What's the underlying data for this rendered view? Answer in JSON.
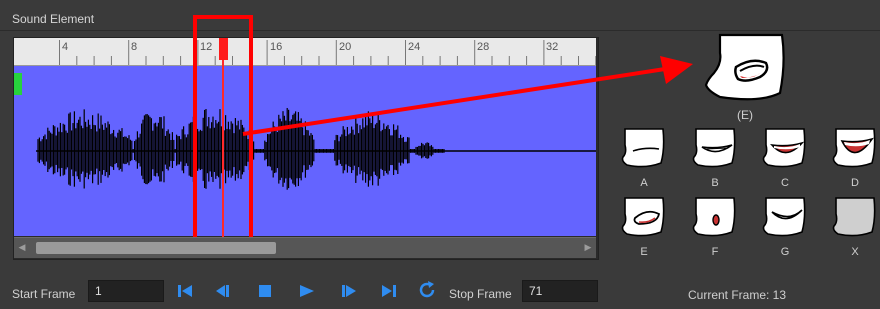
{
  "panel": {
    "title": "Sound Element"
  },
  "ruler": {
    "ticks": [
      "4",
      "8",
      "12",
      "16",
      "20",
      "24",
      "28",
      "32"
    ]
  },
  "mouths": {
    "selected_label": "(E)",
    "items": [
      {
        "label": "A"
      },
      {
        "label": "B"
      },
      {
        "label": "C"
      },
      {
        "label": "D"
      },
      {
        "label": "E"
      },
      {
        "label": "F"
      },
      {
        "label": "G"
      },
      {
        "label": "X"
      }
    ]
  },
  "transport": {
    "start_label": "Start Frame",
    "start_value": "1",
    "stop_label": "Stop Frame",
    "stop_value": "71",
    "current_frame": "Current Frame: 13"
  },
  "icons": {
    "first": "skip-to-first-icon",
    "prev": "previous-frame-icon",
    "stop": "stop-icon",
    "play": "play-icon",
    "next": "next-frame-icon",
    "last": "skip-to-last-icon",
    "loop": "loop-icon"
  },
  "colors": {
    "waveform_bg": "#6464ff",
    "playhead": "#ff2a2a",
    "annotation": "#ff0000",
    "marker": "#27d23d",
    "transport_icon": "#2f8cf0"
  }
}
